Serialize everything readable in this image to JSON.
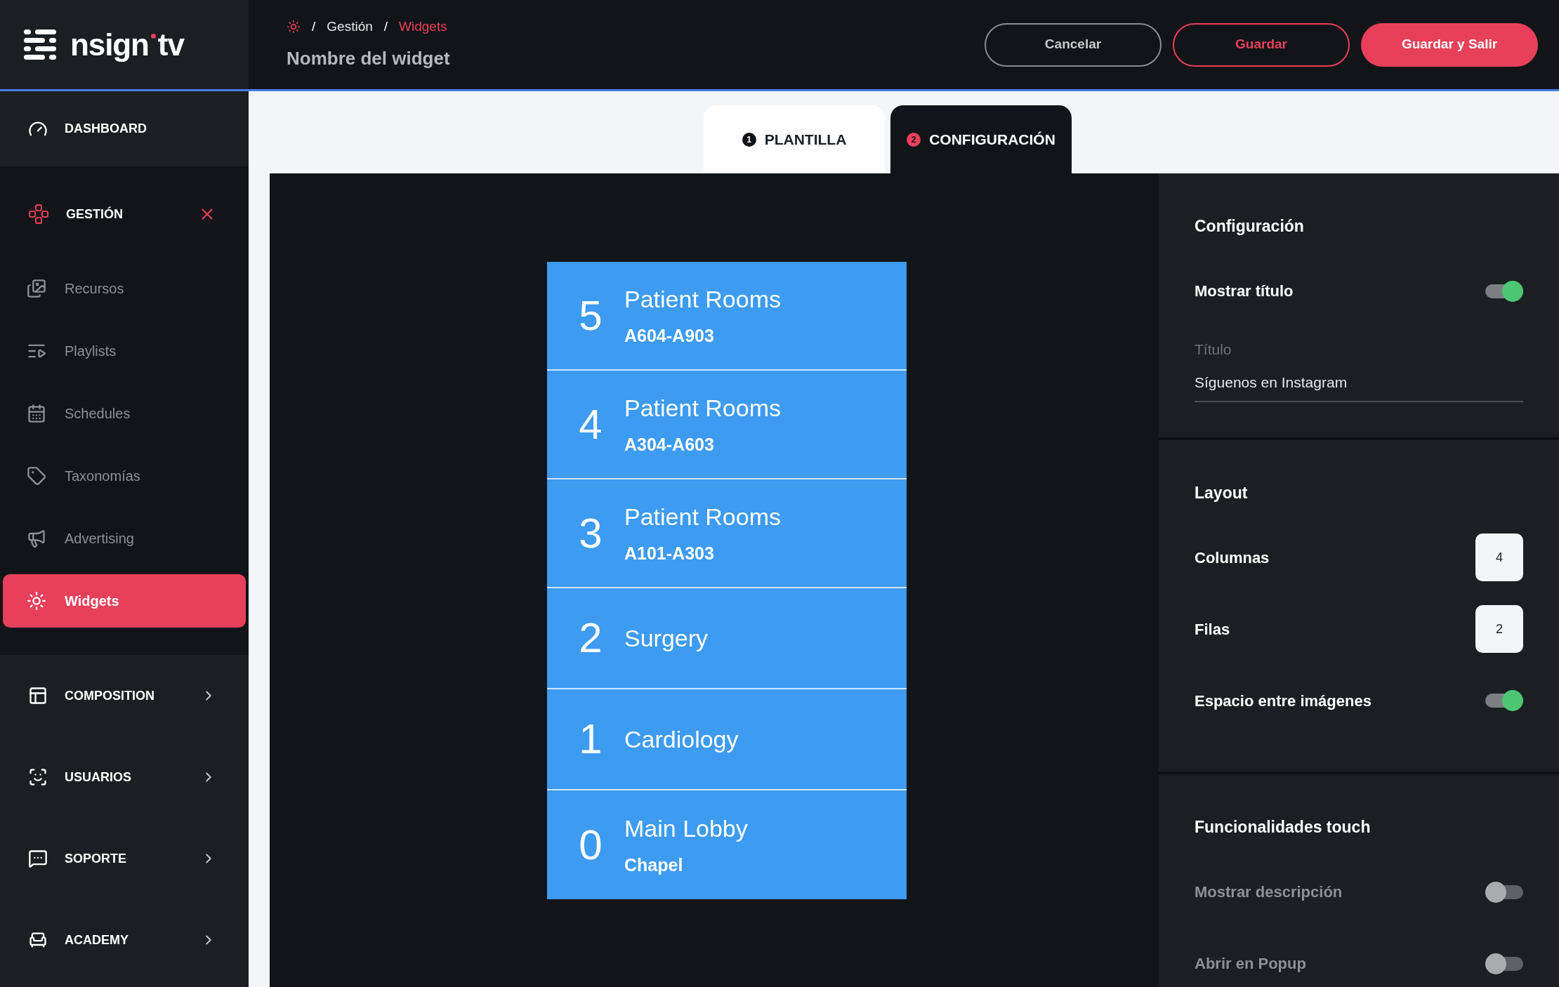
{
  "logo": {
    "name": "nsign",
    "suffix": "tv"
  },
  "breadcrumb": {
    "separator": "/",
    "items": [
      "Gestión",
      "Widgets"
    ]
  },
  "page_title": "Nombre del widget",
  "buttons": [
    {
      "label": "Cancelar",
      "kind": "outline"
    },
    {
      "label": "Guardar",
      "kind": "accent-outline"
    },
    {
      "label": "Guardar y Salir",
      "kind": "solid"
    }
  ],
  "sidebar": [
    {
      "label": "DASHBOARD",
      "kind": "link"
    },
    {
      "label": "GESTIÓN",
      "kind": "group",
      "expanded": true,
      "children": [
        {
          "label": "Recursos",
          "selected": false
        },
        {
          "label": "Playlists",
          "selected": false
        },
        {
          "label": "Schedules",
          "selected": false
        },
        {
          "label": "Taxonomías",
          "selected": false
        },
        {
          "label": "Advertising",
          "selected": false
        },
        {
          "label": "Widgets",
          "selected": true
        }
      ]
    },
    {
      "label": "COMPOSITION",
      "kind": "group",
      "expanded": false
    },
    {
      "label": "USUARIOS",
      "kind": "group",
      "expanded": false
    },
    {
      "label": "SOPORTE",
      "kind": "group",
      "expanded": false
    },
    {
      "label": "ACADEMY",
      "kind": "group",
      "expanded": false
    }
  ],
  "tabs": [
    {
      "number": "1",
      "label": "PLANTILLA",
      "selected": false
    },
    {
      "number": "2",
      "label": "CONFIGURACIÓN",
      "selected": true
    }
  ],
  "directory": [
    {
      "number": "5",
      "title": "Patient Rooms",
      "subtitle": "A604-A903"
    },
    {
      "number": "4",
      "title": "Patient Rooms",
      "subtitle": "A304-A603"
    },
    {
      "number": "3",
      "title": "Patient Rooms",
      "subtitle": "A101-A303"
    },
    {
      "number": "2",
      "title": "Surgery"
    },
    {
      "number": "1",
      "title": "Cardiology"
    },
    {
      "number": "0",
      "title": "Main Lobby",
      "subtitle": "Chapel"
    }
  ],
  "settings": [
    {
      "title": "Configuración",
      "rows": [
        {
          "kind": "toggle",
          "label": "Mostrar título",
          "on": true
        },
        {
          "kind": "field",
          "label": "Título",
          "value": "Síguenos en Instagram"
        }
      ]
    },
    {
      "title": "Layout",
      "rows": [
        {
          "kind": "number",
          "label": "Columnas",
          "value": "4"
        },
        {
          "kind": "number",
          "label": "Filas",
          "value": "2"
        },
        {
          "kind": "toggle",
          "label": "Espacio entre imágenes",
          "on": true
        }
      ]
    },
    {
      "title": "Funcionalidades touch",
      "rows": [
        {
          "kind": "toggle",
          "label": "Mostrar descripción",
          "on": false
        },
        {
          "kind": "toggle",
          "label": "Abrir en Popup",
          "on": false
        }
      ]
    }
  ]
}
